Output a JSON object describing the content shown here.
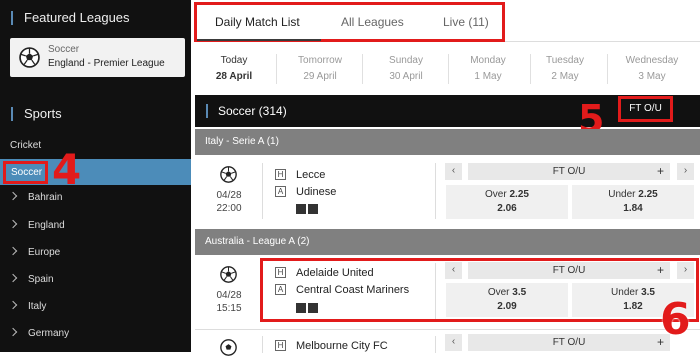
{
  "sidebar": {
    "featured_title": "Featured Leagues",
    "featured": {
      "sport": "Soccer",
      "league": "England - Premier League"
    },
    "sports_title": "Sports",
    "cricket": "Cricket",
    "soccer": "Soccer",
    "items": [
      "Bahrain",
      "England",
      "Europe",
      "Spain",
      "Italy",
      "Germany"
    ]
  },
  "annotations": {
    "n4": "4",
    "n5": "5",
    "n6": "6"
  },
  "tabs": [
    "Daily Match List",
    "All Leagues",
    "Live (11)"
  ],
  "dates": [
    {
      "day": "Today",
      "date": "28 April"
    },
    {
      "day": "Tomorrow",
      "date": "29 April"
    },
    {
      "day": "Sunday",
      "date": "30 April"
    },
    {
      "day": "Monday",
      "date": "1 May"
    },
    {
      "day": "Tuesday",
      "date": "2 May"
    },
    {
      "day": "Wednesday",
      "date": "3 May"
    }
  ],
  "soccer_bar": {
    "title": "Soccer (314)",
    "market": "FT O/U"
  },
  "leagues": [
    {
      "name": "Italy - Serie A (1)",
      "match": {
        "date": "04/28",
        "time": "22:00",
        "home_tag": "H",
        "home": "Lecce",
        "away_tag": "A",
        "away": "Udinese",
        "market": "FT O/U",
        "over_label": "Over",
        "over_line": "2.25",
        "over_odd": "2.06",
        "under_label": "Under",
        "under_line": "2.25",
        "under_odd": "1.84"
      }
    },
    {
      "name": "Australia - League A (2)",
      "match": {
        "date": "04/28",
        "time": "15:15",
        "home_tag": "H",
        "home": "Adelaide United",
        "away_tag": "A",
        "away": "Central Coast Mariners",
        "market": "FT O/U",
        "over_label": "Over",
        "over_line": "3.5",
        "over_odd": "2.09",
        "under_label": "Under",
        "under_line": "3.5",
        "under_odd": "1.82"
      },
      "match2": {
        "home_tag": "H",
        "home": "Melbourne City FC",
        "market": "FT O/U"
      }
    }
  ],
  "buttons": {
    "prev": "‹",
    "next": "›",
    "plus": "+"
  }
}
